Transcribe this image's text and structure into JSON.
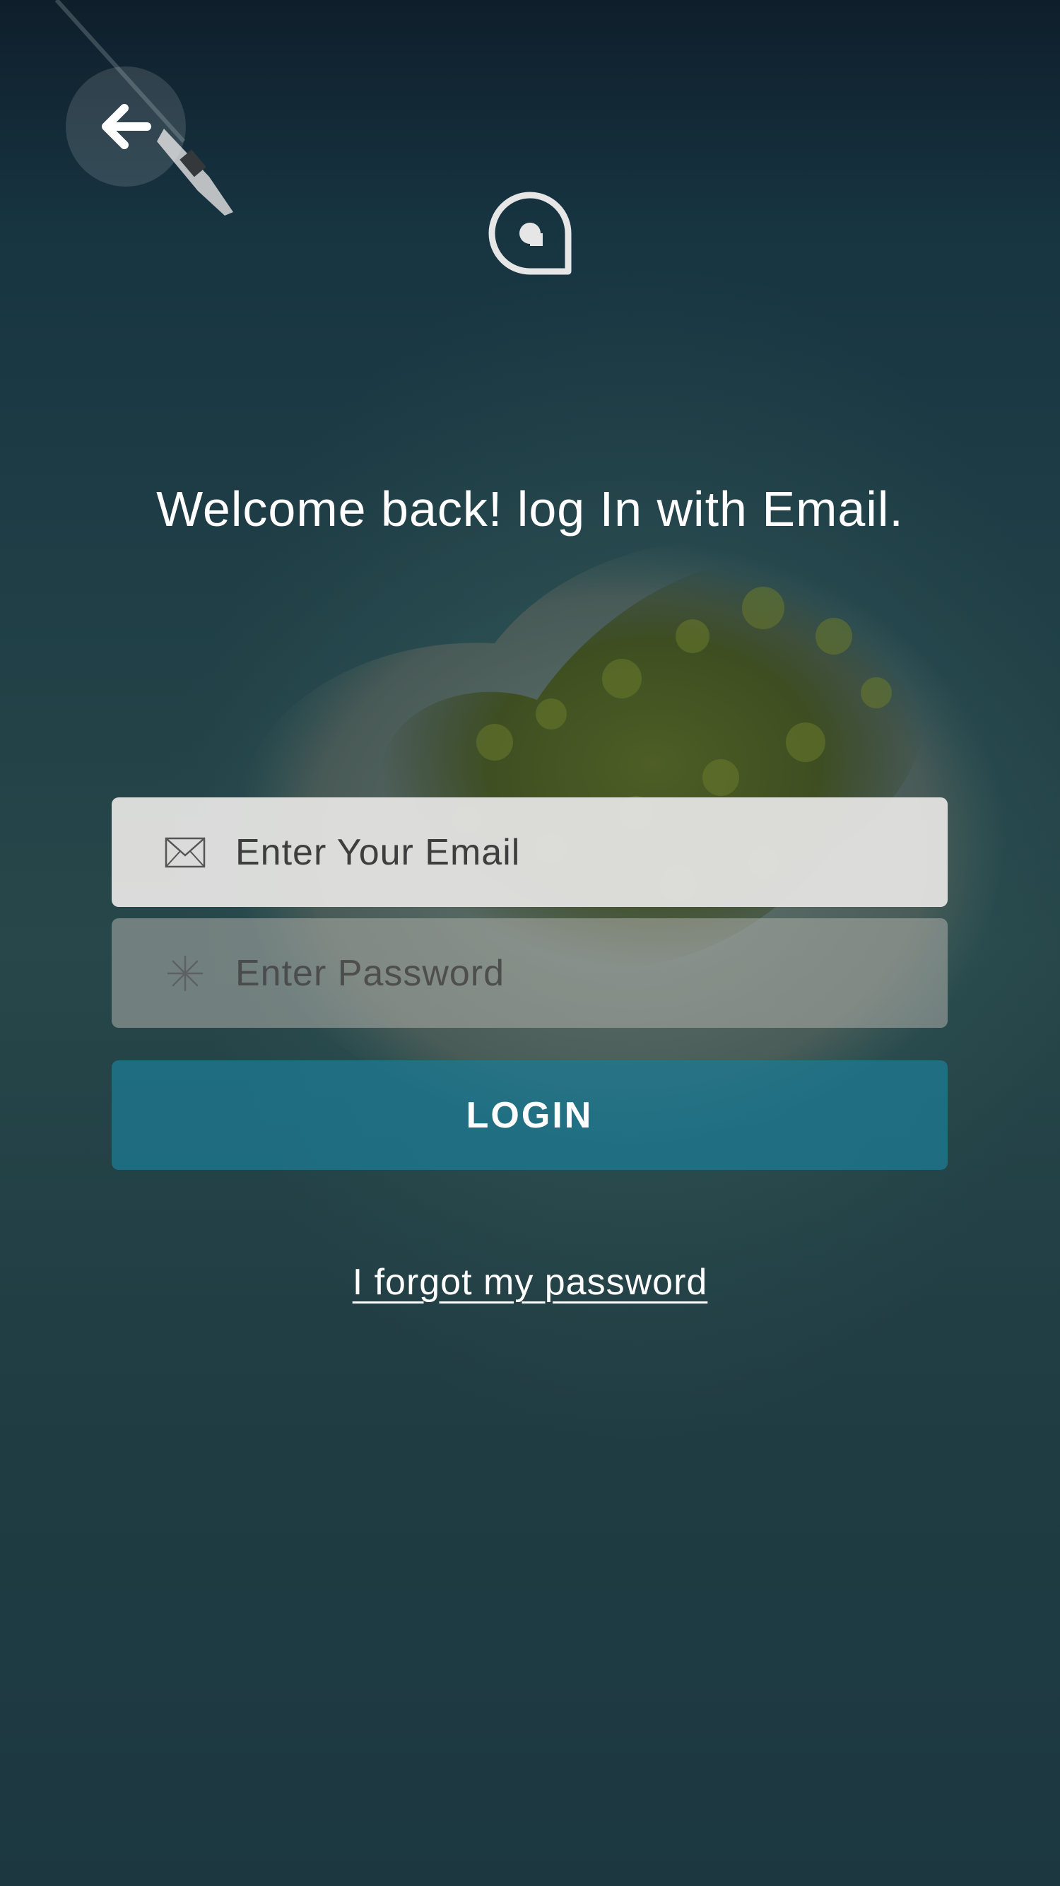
{
  "header": {
    "back_icon": "arrow-left-icon",
    "logo_icon": "location-pin-logo"
  },
  "title": "Welcome back! log In with Email.",
  "form": {
    "email": {
      "icon": "envelope-icon",
      "placeholder": "Enter Your Email",
      "value": ""
    },
    "password": {
      "icon": "asterisk-icon",
      "placeholder": "Enter Password",
      "value": ""
    },
    "login_label": "LOGIN"
  },
  "forgot_password_label": "I forgot my password",
  "colors": {
    "accent": "#1e7891",
    "text": "#ffffff",
    "background": "#1f3e46"
  }
}
